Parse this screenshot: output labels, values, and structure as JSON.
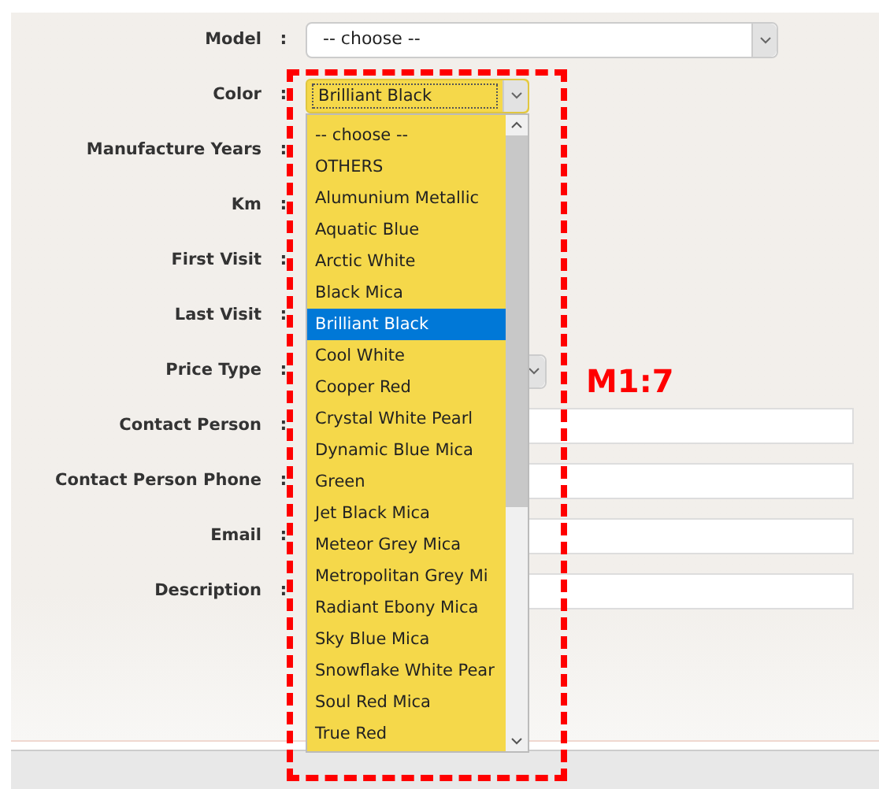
{
  "fields": [
    {
      "label": "Model",
      "colon": ":",
      "kind": "select",
      "value": "-- choose --"
    },
    {
      "label": "Color",
      "colon": ":",
      "kind": "dropdown",
      "value": "Brilliant Black",
      "expanded": true,
      "options": [
        {
          "label": "-- choose --",
          "selected": false
        },
        {
          "label": "OTHERS",
          "selected": false
        },
        {
          "label": "Alumunium Metallic",
          "selected": false
        },
        {
          "label": "Aquatic Blue",
          "selected": false
        },
        {
          "label": "Arctic White",
          "selected": false
        },
        {
          "label": "Black Mica",
          "selected": false
        },
        {
          "label": "Brilliant Black",
          "selected": true
        },
        {
          "label": "Cool White",
          "selected": false
        },
        {
          "label": "Cooper Red",
          "selected": false
        },
        {
          "label": "Crystal White Pearl",
          "selected": false
        },
        {
          "label": "Dynamic Blue Mica",
          "selected": false
        },
        {
          "label": "Green",
          "selected": false
        },
        {
          "label": "Jet Black Mica",
          "selected": false
        },
        {
          "label": "Meteor Grey Mica",
          "selected": false
        },
        {
          "label": "Metropolitan Grey Mi",
          "selected": false
        },
        {
          "label": "Radiant Ebony Mica",
          "selected": false
        },
        {
          "label": "Sky Blue Mica",
          "selected": false
        },
        {
          "label": "Snowflake White Pear",
          "selected": false
        },
        {
          "label": "Soul Red Mica",
          "selected": false
        },
        {
          "label": "True Red",
          "selected": false
        }
      ]
    },
    {
      "label": "Manufacture Years",
      "colon": ":"
    },
    {
      "label": "Km",
      "colon": ":"
    },
    {
      "label": "First Visit",
      "colon": ":"
    },
    {
      "label": "Last Visit",
      "colon": ":"
    },
    {
      "label": "Price Type",
      "colon": ":",
      "kind": "select"
    },
    {
      "label": "Contact Person",
      "colon": ":",
      "kind": "text"
    },
    {
      "label": "Contact Person Phone",
      "colon": ":",
      "kind": "text"
    },
    {
      "label": "Email",
      "colon": ":",
      "kind": "text"
    },
    {
      "label": "Description",
      "colon": ":",
      "kind": "text"
    }
  ],
  "annotation": "M1:7"
}
